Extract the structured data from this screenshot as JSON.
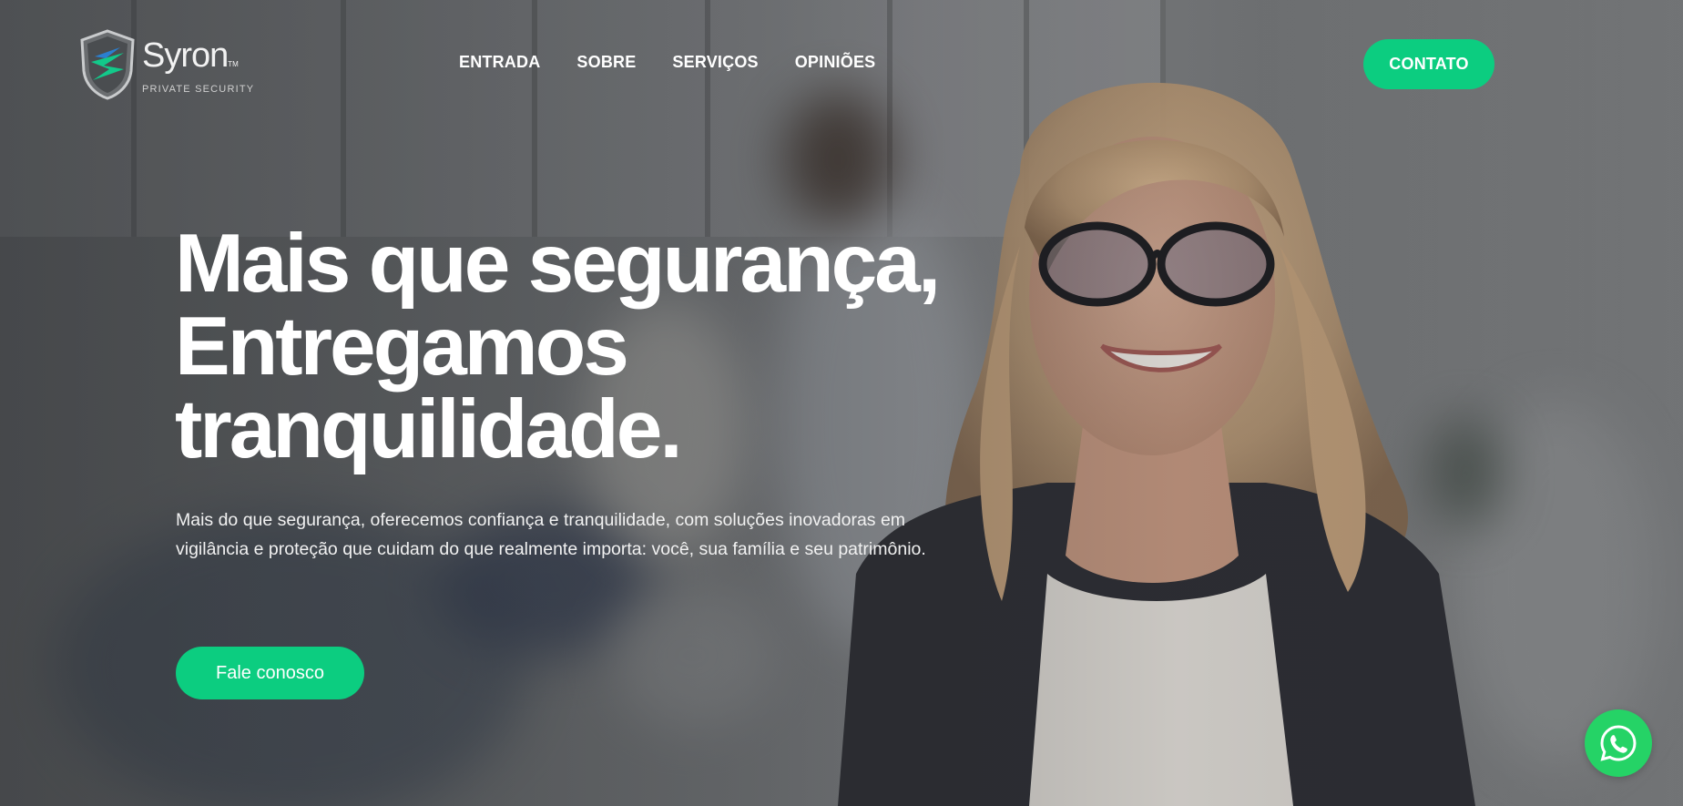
{
  "brand": {
    "name": "Syron",
    "tm": "TM",
    "tagline": "PRIVATE SECURITY"
  },
  "nav": {
    "items": [
      {
        "label": "ENTRADA"
      },
      {
        "label": "SOBRE"
      },
      {
        "label": "SERVIÇOS"
      },
      {
        "label": "OPINIÕES"
      }
    ]
  },
  "header": {
    "contact_button": "CONTATO"
  },
  "hero": {
    "title_line1": "Mais que segurança,",
    "title_line2": "Entregamos",
    "title_line3": "tranquilidade.",
    "description": "Mais do que segurança, oferecemos confiança e tranquilidade, com soluções inovadoras em vigilância e proteção que cuidam do que realmente importa: você, sua família e seu patrimônio.",
    "cta": "Fale conosco"
  },
  "floating": {
    "whatsapp_icon": "whatsapp-icon"
  },
  "colors": {
    "accent": "#0ccd80",
    "whatsapp": "#25d366",
    "text": "#ffffff"
  }
}
